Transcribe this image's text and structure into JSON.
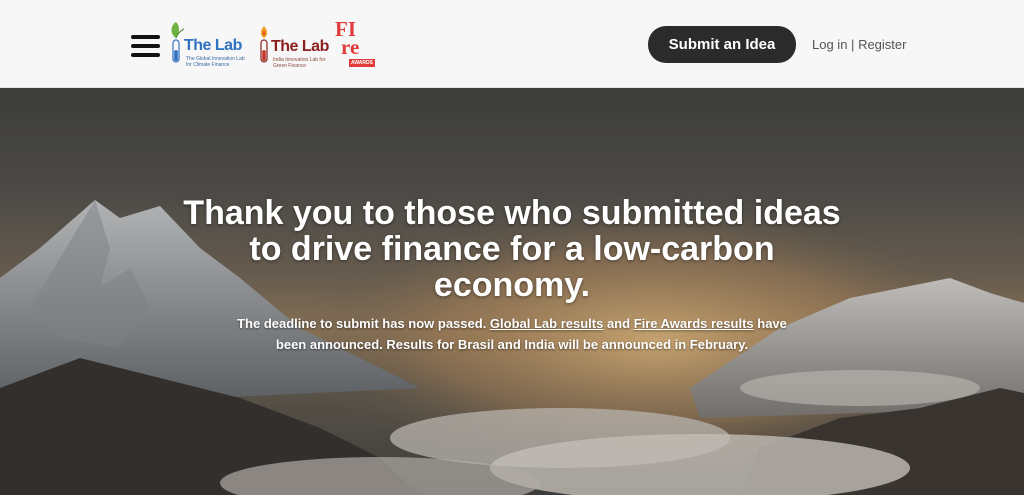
{
  "header": {
    "logos": [
      {
        "name": "The Lab",
        "tagline": "The Global Innovation Lab for Climate Finance",
        "color": "#2f72c0"
      },
      {
        "name": "The Lab",
        "tagline": "India Innovation Lab for Green Finance",
        "color": "#8c1f1f"
      },
      {
        "name": "FIre",
        "line1": "FI",
        "line2": "re",
        "badge": "AWARDS",
        "color": "#e23b3b"
      }
    ],
    "submit_label": "Submit an Idea",
    "login_label": "Log in",
    "separator": "|",
    "register_label": "Register"
  },
  "hero": {
    "title": "Thank you to those who submitted ideas to drive finance for a low-carbon economy.",
    "desc_part1": "The deadline to submit has now passed. ",
    "link_global": "Global Lab results",
    "desc_and": " and ",
    "link_fire": "Fire Awards results",
    "desc_part2": " have been announced. Results for Brasil and India will be announced in February."
  }
}
